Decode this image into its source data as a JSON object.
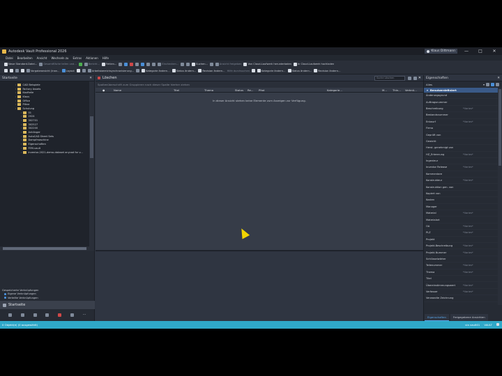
{
  "window": {
    "title": "Autodesk Vault Professional 2026",
    "user": "Klaus Dittmann",
    "controls": [
      "—",
      "□",
      "✕"
    ]
  },
  "menu": [
    "Datei",
    "Bearbeiten",
    "Ansicht",
    "Wechseln zu",
    "Extras",
    "Aktionen",
    "Hilfe"
  ],
  "toolbar1": [
    {
      "label": "Neue Standard-Datei...",
      "icon": "new-file-icon"
    },
    {
      "label": "Gesamtfläche teilen und...",
      "icon": "share-icon"
    },
    {
      "label": "Bericht...",
      "icon": "report-icon"
    },
    {
      "label": "Fehlen...",
      "icon": "error-icon"
    },
    {
      "label": "Einchecken...",
      "icon": "checkin-icon"
    },
    {
      "label": "Suchen...",
      "icon": "search-icon"
    },
    {
      "label": "Ansicht freigeben",
      "icon": "share-view-icon"
    },
    {
      "label": "Von Cloud-Laufwerk herunterladen",
      "icon": "cloud-down-icon"
    },
    {
      "label": "In Cloud-Laufwerk hochladen",
      "icon": "cloud-up-icon"
    }
  ],
  "toolbar2": [
    {
      "label": "Vorgabeansicht (Inan...",
      "icon": "view-icon"
    },
    {
      "label": "Layout",
      "icon": "layout-icon"
    },
    {
      "label": "Arbeitsbereichsynchronisierung...",
      "icon": "sync-icon"
    },
    {
      "label": "Kategorie ändern...",
      "icon": "category-icon"
    },
    {
      "label": "Status ändern...",
      "icon": "status-icon"
    },
    {
      "label": "Revision ändern...",
      "icon": "revision-icon"
    },
    {
      "label": "Hilfe durchsuchen",
      "icon": "help-icon"
    },
    {
      "label": "Kategorie ändern...",
      "icon": "category-icon"
    },
    {
      "label": "Status ändern...",
      "icon": "status-icon"
    },
    {
      "label": "Revision ändern...",
      "icon": "revision-icon"
    }
  ],
  "left": {
    "title": "Startseite",
    "tree": [
      {
        "label": "CAD Beispiele",
        "indent": 2
      },
      {
        "label": "Factory Assets",
        "indent": 2
      },
      {
        "label": "Kaufteile",
        "indent": 2
      },
      {
        "label": "Klaus",
        "indent": 2
      },
      {
        "label": "Office",
        "indent": 2
      },
      {
        "label": "Pläne",
        "indent": 2
      },
      {
        "label": "Schulung",
        "indent": 2
      },
      {
        "label": "01",
        "indent": 3
      },
      {
        "label": "2024",
        "indent": 3
      },
      {
        "label": "302701",
        "indent": 3
      },
      {
        "label": "302527",
        "indent": 3
      },
      {
        "label": "302200",
        "indent": 3
      },
      {
        "label": "Anhänger",
        "indent": 3
      },
      {
        "label": "AutoCAD Sheet Sets",
        "indent": 3
      },
      {
        "label": "Dampfmaschine",
        "indent": 3
      },
      {
        "label": "Eigenschaften",
        "indent": 3
      },
      {
        "label": "FEM-vault",
        "indent": 3
      },
      {
        "label": "inventor-2021-demo-dataset anycad for v...",
        "indent": 3
      }
    ],
    "saved_title": "Gespeicherte Verknüpfungen",
    "saved": [
      "Eigene Verknüpfungen",
      "Verteilte Verknüpfungen"
    ],
    "add_group": "Neue Gruppe hinzufügen",
    "home_tab": "Startseite"
  },
  "center": {
    "title": "Löschen",
    "search_placeholder": "Suche Löschen",
    "group_hint": "Spaltenüberschrift zum Gruppieren nach dieser Spalte hierher ziehen",
    "columns": [
      "Name",
      "Titel",
      "Thema",
      "Status",
      "Re...",
      "Pfad",
      "Kategorie...",
      "M...",
      "Thin...",
      "Verknü..."
    ],
    "empty_message": "In dieser Ansicht stehen keine Elemente zum Anzeigen zur Verfügung."
  },
  "right": {
    "title": "Eigenschaften",
    "filter": "Alles",
    "group_header": "Benutzerdefiniert",
    "properties": [
      {
        "name": "Änderungsgrund",
        "value": ""
      },
      {
        "name": "Auftragsnummer",
        "value": ""
      },
      {
        "name": "Beschreibung",
        "value": "*Varies*"
      },
      {
        "name": "Bestandsnummer",
        "value": ""
      },
      {
        "name": "Entwurf",
        "value": "*Varies*"
      },
      {
        "name": "Firma",
        "value": ""
      },
      {
        "name": "Geprüft von",
        "value": ""
      },
      {
        "name": "Gewicht",
        "value": ""
      },
      {
        "name": "Herst. genehmigt von",
        "value": ""
      },
      {
        "name": "HZ_Erkennung",
        "value": "*Varies*"
      },
      {
        "name": "Ingenieur",
        "value": ""
      },
      {
        "name": "Inventor Release",
        "value": "*Varies*"
      },
      {
        "name": "Kommentare",
        "value": ""
      },
      {
        "name": "Konstrukteur",
        "value": "*Varies*"
      },
      {
        "name": "Konstruktion gen. von",
        "value": ""
      },
      {
        "name": "Kopiert von",
        "value": ""
      },
      {
        "name": "Kosten",
        "value": ""
      },
      {
        "name": "Manager",
        "value": ""
      },
      {
        "name": "Material",
        "value": "*Varies*"
      },
      {
        "name": "Materialart",
        "value": ""
      },
      {
        "name": "OA",
        "value": "*Varies*"
      },
      {
        "name": "PLZ",
        "value": "*Varies*"
      },
      {
        "name": "Projekt",
        "value": ""
      },
      {
        "name": "Projekt-Beschreibung",
        "value": "*Varies*"
      },
      {
        "name": "Projekt-Nummer",
        "value": "*Varies*"
      },
      {
        "name": "Schlüsselwörter",
        "value": ""
      },
      {
        "name": "Teilenummer",
        "value": "*Varies*"
      },
      {
        "name": "Thema",
        "value": "*Varies*"
      },
      {
        "name": "Titel",
        "value": ""
      },
      {
        "name": "Übereinstimmungswert",
        "value": "*Varies*"
      },
      {
        "name": "Verfasser",
        "value": "*Varies*"
      },
      {
        "name": "Verwandte Zeichnung",
        "value": ""
      }
    ],
    "tabs": [
      "Eigenschaften",
      "Freigegebene Ansichten"
    ]
  },
  "status": {
    "left": "0 Objekt(e) (0 ausgewählt)",
    "right": [
      "via vault01",
      "VAULT"
    ]
  },
  "colors": {
    "status_bar": "#2fa8c8",
    "accent": "#58a6e8",
    "folder": "#d8b65a"
  }
}
